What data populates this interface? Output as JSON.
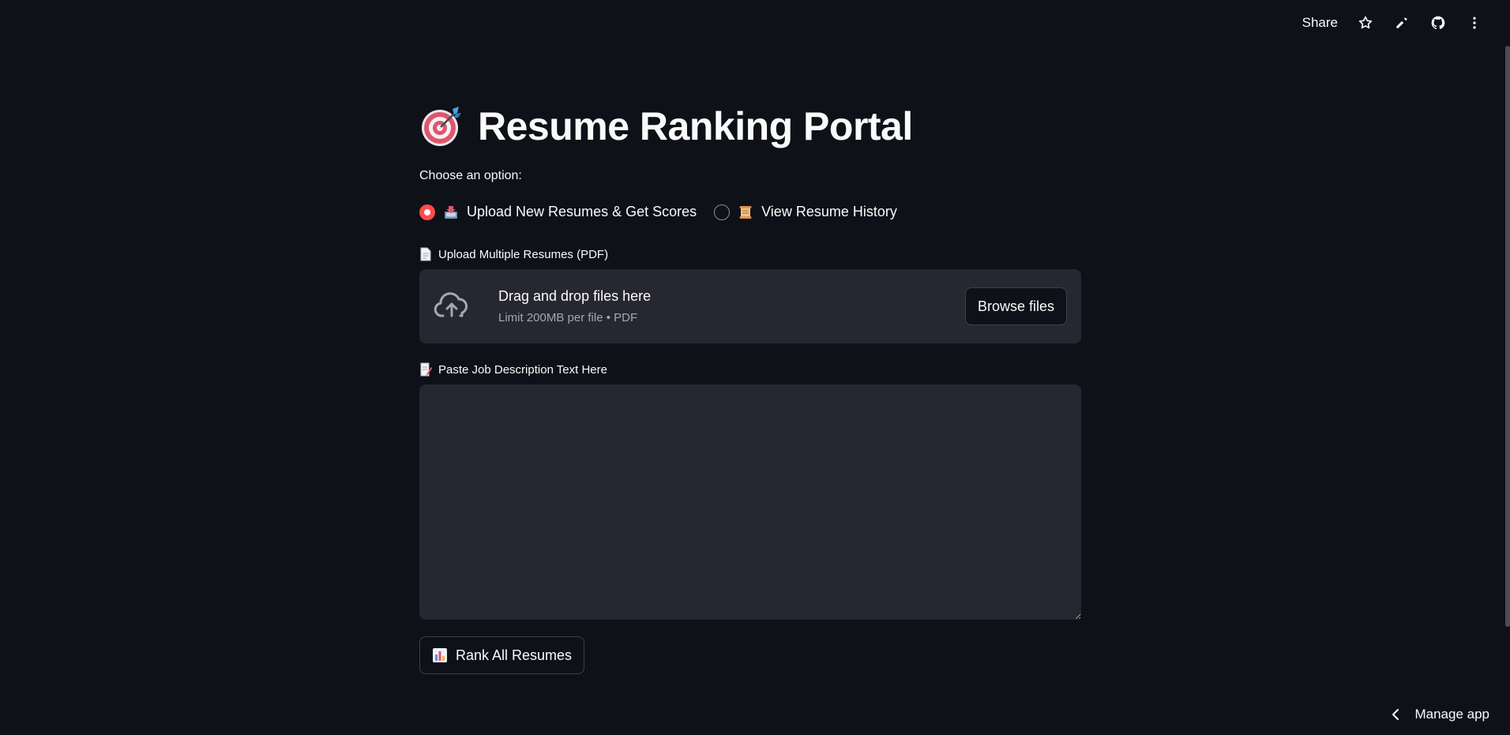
{
  "toolbar": {
    "share_label": "Share",
    "icons": [
      "star-icon",
      "pencil-icon",
      "github-icon",
      "more-vertical-icon"
    ]
  },
  "main": {
    "title": "Resume Ranking Portal",
    "title_icon": "target-dart-icon",
    "choose_label": "Choose an option:",
    "options": [
      {
        "label": "Upload New Resumes & Get Scores",
        "icon": "inbox-tray-icon",
        "selected": true
      },
      {
        "label": "View Resume History",
        "icon": "scroll-icon",
        "selected": false
      }
    ],
    "upload": {
      "label": "Upload Multiple Resumes (PDF)",
      "dropzone_title": "Drag and drop files here",
      "dropzone_sub": "Limit 200MB per file • PDF",
      "browse_label": "Browse files"
    },
    "job_description": {
      "label": "Paste Job Description Text Here",
      "value": "",
      "placeholder": ""
    },
    "rank_button_label": "Rank All Resumes"
  },
  "footer": {
    "manage_label": "Manage app"
  },
  "colors": {
    "background": "#0e1117",
    "surface": "#262730",
    "accent": "#ff4b4b",
    "text": "#fafafa",
    "muted": "#a3a8b4"
  }
}
